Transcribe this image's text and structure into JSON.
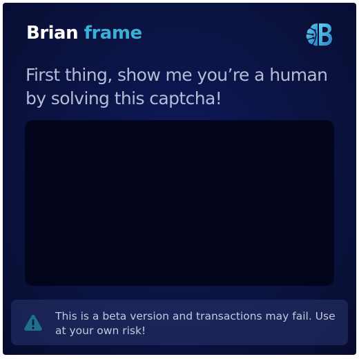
{
  "header": {
    "brand_primary": "Brian",
    "brand_accent": "frame",
    "logo_icon": "brian-brain-logo-icon"
  },
  "main": {
    "headline": "First thing, show me you’re a human by solving this captcha!"
  },
  "notice": {
    "icon": "warning-icon",
    "text": "This is a beta version and transactions may fail. Use at your own risk!"
  },
  "colors": {
    "background": "#0b1445",
    "accent": "#3ab0d6",
    "captcha_panel": "#03051c",
    "text_muted": "#b5bdd6"
  }
}
